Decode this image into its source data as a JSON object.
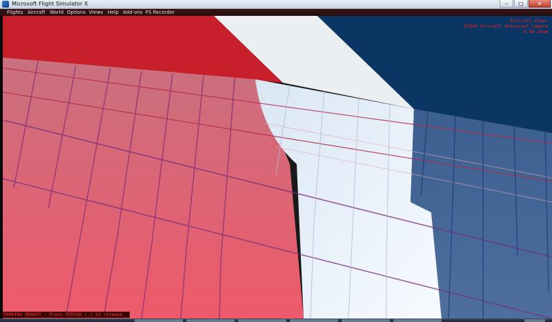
{
  "window": {
    "title": "Microsoft Flight Simulator X",
    "controls": {
      "minimize": "–",
      "maximize": "□",
      "close": "✕"
    }
  },
  "menu": {
    "items": [
      "Flights",
      "Aircraft",
      "World",
      "Options",
      "Views",
      "Help",
      "Add-ons",
      "FS Recorder"
    ]
  },
  "view_info": {
    "line1": "Aircraft View:",
    "line2": "EZdok Aircraft Universal camera",
    "line3": "0.98 Zoom"
  },
  "status": {
    "parking_brakes": "PARKING BRAKES - Press PERIOD (.) to release."
  },
  "colors": {
    "tail_red": "#c8202a",
    "tail_white": "#eceff2",
    "tail_blue": "#0b3563",
    "wing_red": "#e25a6a",
    "wing_white": "#f2f7fc",
    "wing_blue": "#47679a",
    "overlay_text": "#ff2020"
  }
}
